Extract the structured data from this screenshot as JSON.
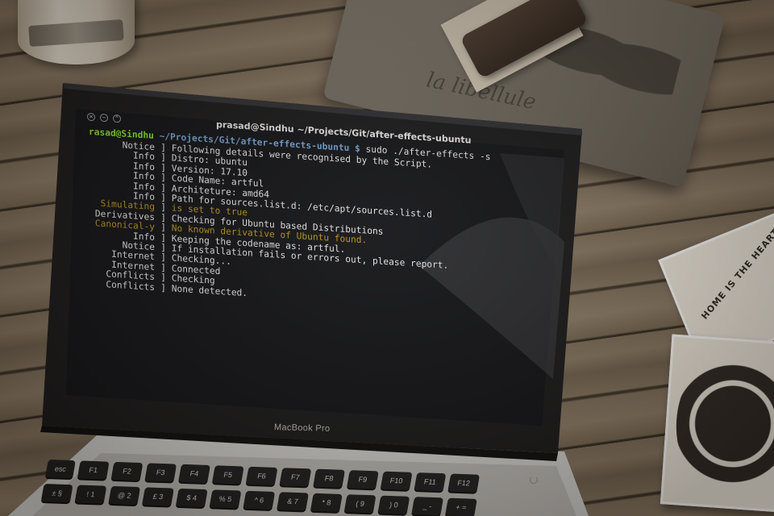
{
  "window": {
    "title": "prasad@Sindhu ~/Projects/Git/after-effects-ubuntu"
  },
  "prompt": {
    "user_host": "rasad@Sindhu",
    "path": " ~/Projects/Git/after-effects-ubuntu $",
    "command": " sudo ./after-effects -s"
  },
  "log": [
    {
      "tag": "Notice",
      "text": "Following details were recognised by the Script.",
      "tag_color": "white",
      "text_color": "white"
    },
    {
      "tag": "Info",
      "text": "Distro: ubuntu",
      "tag_color": "white",
      "text_color": "white"
    },
    {
      "tag": "Info",
      "text": "Version: 17.10",
      "tag_color": "white",
      "text_color": "white"
    },
    {
      "tag": "Info",
      "text": "Code Name: artful",
      "tag_color": "white",
      "text_color": "white"
    },
    {
      "tag": "Info",
      "text": "Architeture: amd64",
      "tag_color": "white",
      "text_color": "white"
    },
    {
      "tag": "Info",
      "text": "Path for sources.list.d: /etc/apt/sources.list.d",
      "tag_color": "white",
      "text_color": "white"
    },
    {
      "tag": "Simulating",
      "text": "is set to true",
      "tag_color": "amber",
      "text_color": "amber"
    },
    {
      "tag": "Derivatives",
      "text": "Checking for Ubuntu based Distributions",
      "tag_color": "white",
      "text_color": "white"
    },
    {
      "tag": "Canonical-y",
      "text": "No known derivative of Ubuntu found.",
      "tag_color": "amber",
      "text_color": "amber"
    },
    {
      "tag": "Info",
      "text": "Keeping the codename as: artful.",
      "tag_color": "white",
      "text_color": "white"
    },
    {
      "tag": "Notice",
      "text": "If installation fails or errors out, please report.",
      "tag_color": "white",
      "text_color": "white"
    },
    {
      "tag": "Internet",
      "text": "Checking...",
      "tag_color": "white",
      "text_color": "white"
    },
    {
      "tag": "Internet",
      "text": "Connected",
      "tag_color": "white",
      "text_color": "white"
    },
    {
      "tag": "Conflicts",
      "text": "Checking",
      "tag_color": "white",
      "text_color": "white"
    },
    {
      "tag": "Conflicts",
      "text": "None detected.",
      "tag_color": "white",
      "text_color": "white"
    }
  ],
  "laptop": {
    "brand_label": "MacBook Pro"
  },
  "props": {
    "pouch_text": "la libellule",
    "coaster_text": "HOME IS THE HEART OF THE HOLIDAYS"
  },
  "keyboard": {
    "row1": [
      "esc",
      "F1",
      "F2",
      "F3",
      "F4",
      "F5",
      "F6",
      "F7",
      "F8",
      "F9",
      "F10",
      "F11",
      "F12"
    ],
    "row2": [
      "±",
      "!",
      "@",
      "£",
      "$",
      "%",
      "^",
      "&",
      "*",
      "(",
      ")",
      "_",
      "+"
    ],
    "row2_sub": [
      "§",
      "1",
      "2",
      "3",
      "4",
      "5",
      "6",
      "7",
      "8",
      "9",
      "0",
      "-",
      "="
    ]
  },
  "colors": {
    "terminal_bg": "#0d0f14",
    "prompt_user": "#8ae234",
    "prompt_path": "#729fcf",
    "text_white": "#e6e6e6",
    "text_amber": "#b8951f"
  },
  "icons": [
    "close-icon",
    "minimize-icon",
    "maximize-icon",
    "power-icon"
  ]
}
